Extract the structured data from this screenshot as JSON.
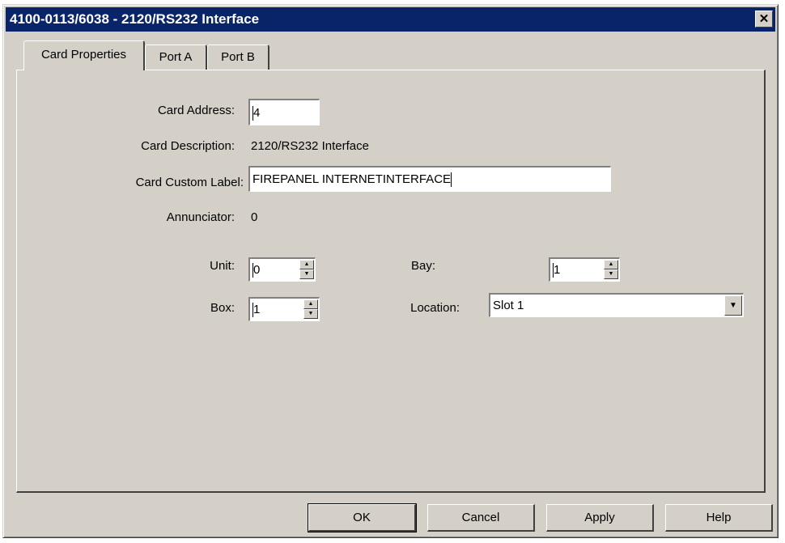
{
  "window": {
    "title": "4100-0113/6038 - 2120/RS232 Interface",
    "close_glyph": "✕"
  },
  "tabs": [
    "Card Properties",
    "Port A",
    "Port B"
  ],
  "form": {
    "card_address_label": "Card Address:",
    "card_address_value": "4",
    "card_description_label": "Card Description:",
    "card_description_value": "2120/RS232 Interface",
    "card_custom_label_label": "Card Custom Label:",
    "card_custom_label_value": "FIREPANEL INTERNETINTERFACE",
    "annunciator_label": "Annunciator:",
    "annunciator_value": "0",
    "unit_label": "Unit:",
    "unit_value": "0",
    "bay_label": "Bay:",
    "bay_value": "1",
    "box_label": "Box:",
    "box_value": "1",
    "location_label": "Location:",
    "location_value": "Slot 1"
  },
  "buttons": {
    "ok": "OK",
    "cancel": "Cancel",
    "apply": "Apply",
    "help": "Help"
  },
  "colors": {
    "titlebar": "#0a246a",
    "dialog_face": "#d4d0c8"
  }
}
